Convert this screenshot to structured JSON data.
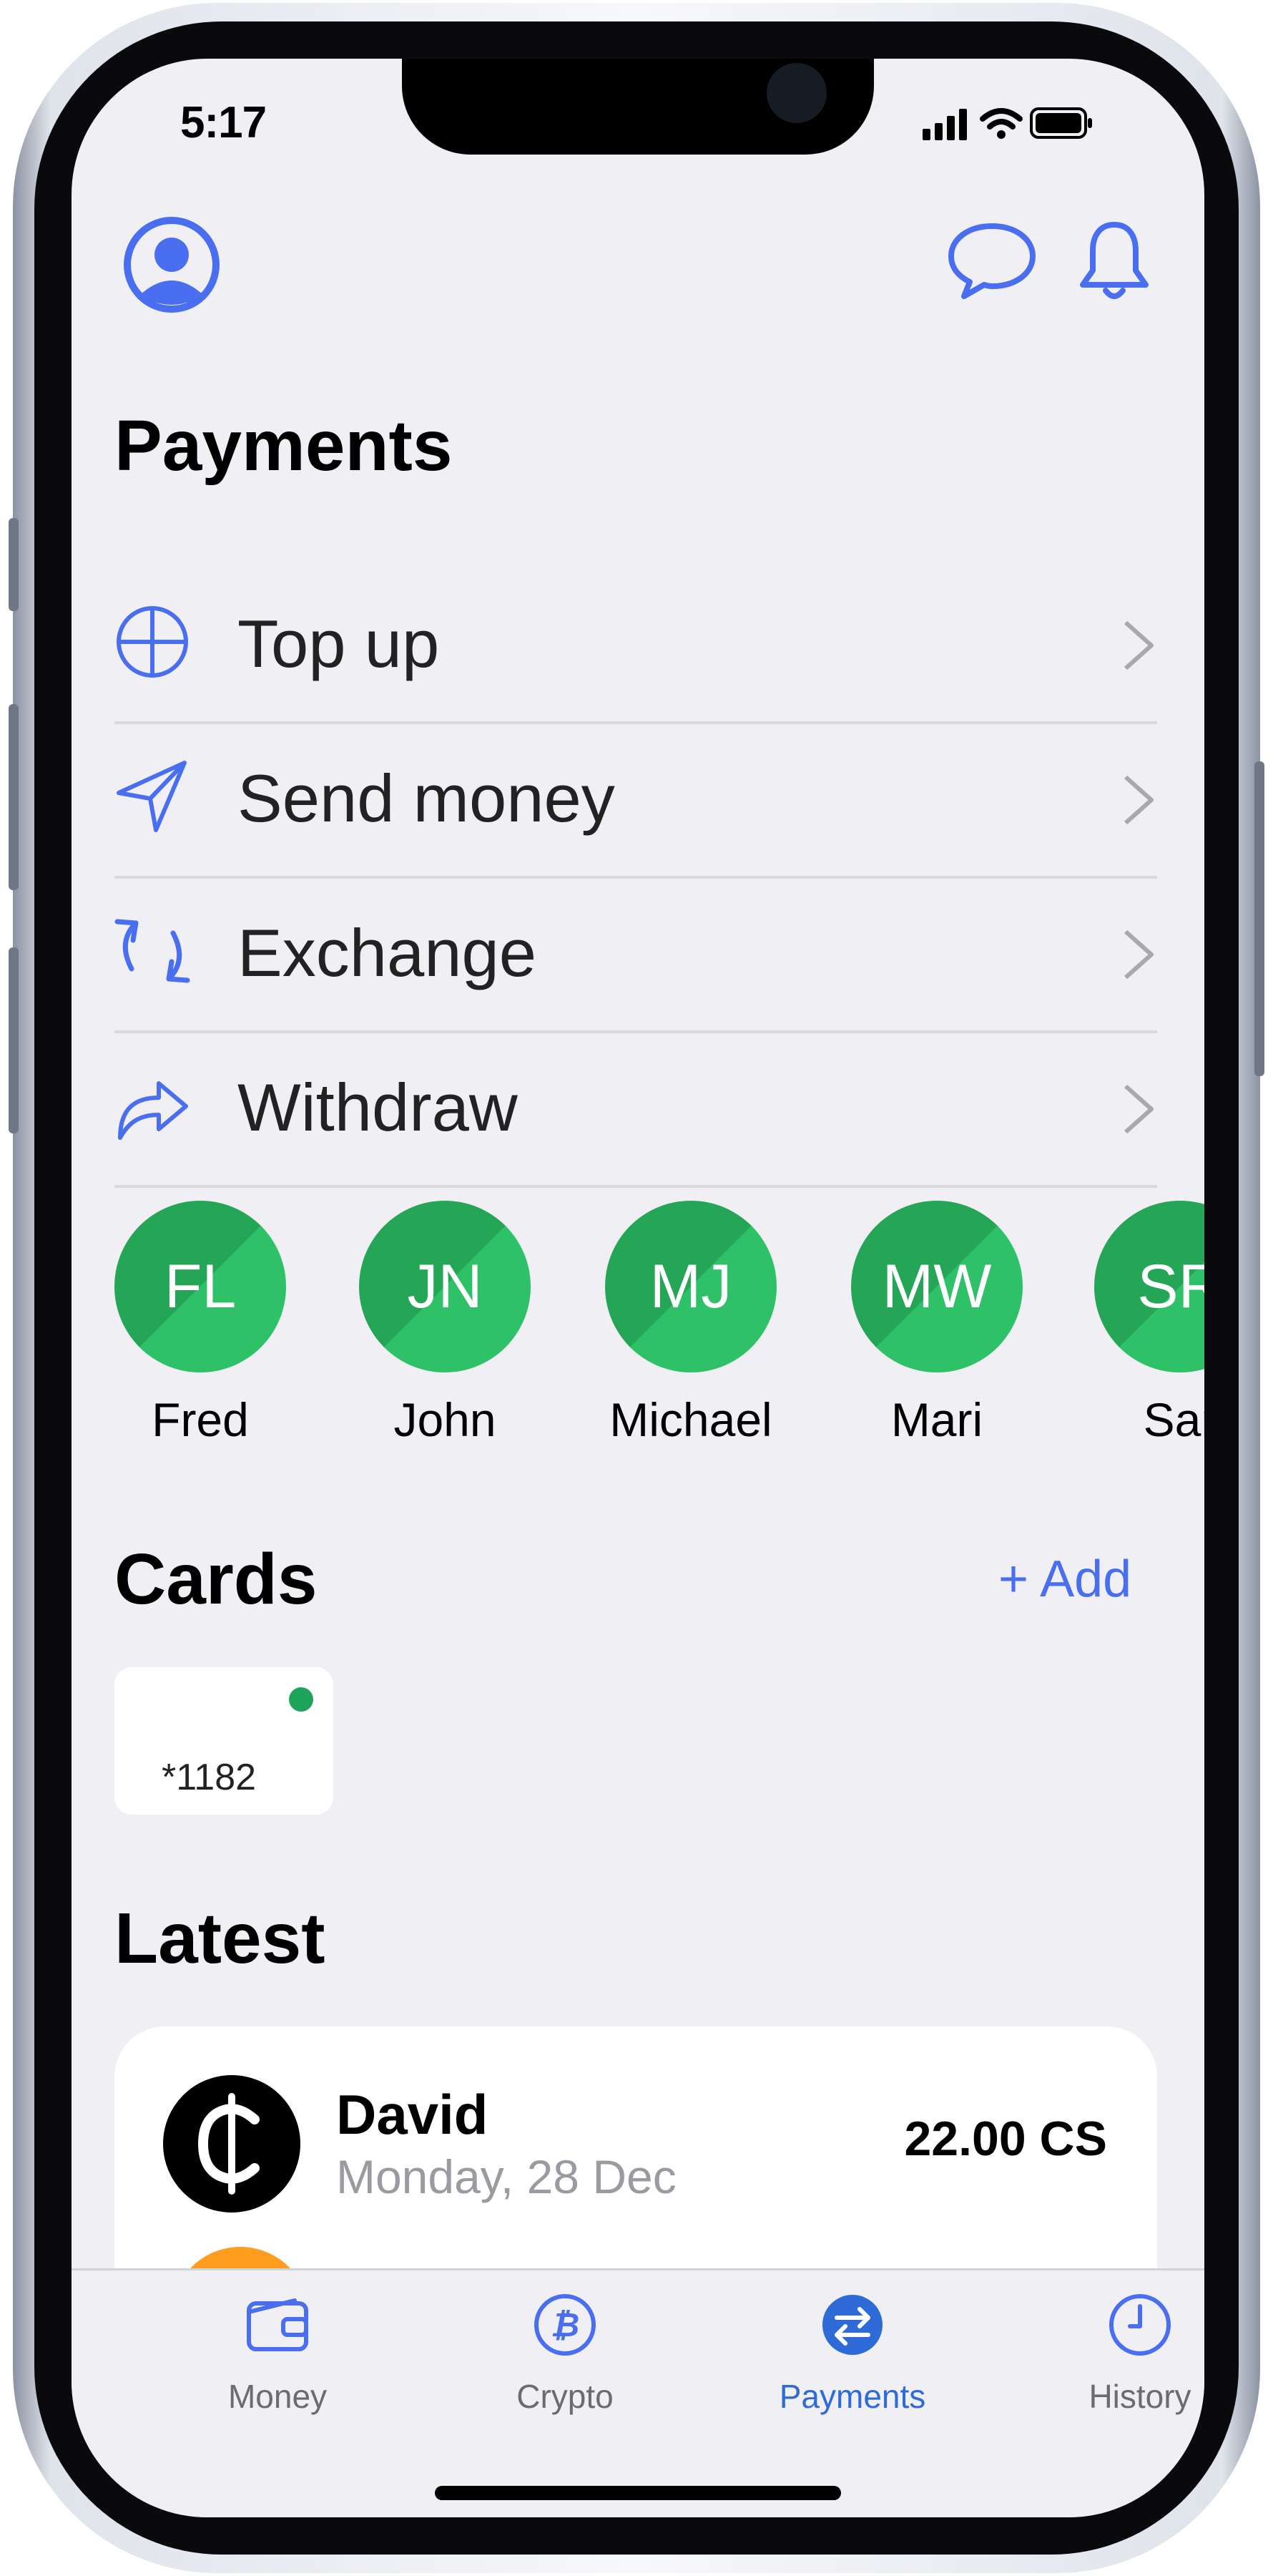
{
  "status_bar": {
    "time": "5:17"
  },
  "header": {
    "profile_icon": "user-circle-icon",
    "chat_icon": "chat-bubble-icon",
    "bell_icon": "bell-icon",
    "accent_color": "#4a6ef0"
  },
  "payments": {
    "title": "Payments",
    "items": [
      {
        "label": "Top up",
        "icon": "plus-circle-icon"
      },
      {
        "label": "Send money",
        "icon": "paper-plane-icon"
      },
      {
        "label": "Exchange",
        "icon": "refresh-arrows-icon"
      },
      {
        "label": "Withdraw",
        "icon": "share-arrow-icon"
      }
    ]
  },
  "contacts": [
    {
      "initials": "FL",
      "name": "Fred"
    },
    {
      "initials": "JN",
      "name": "John"
    },
    {
      "initials": "MJ",
      "name": "Michael"
    },
    {
      "initials": "MW",
      "name": "Mari"
    },
    {
      "initials": "SR",
      "name": "Sar"
    }
  ],
  "cards": {
    "title": "Cards",
    "add_label": "+ Add",
    "items": [
      {
        "number": "*1182",
        "status_color": "#1ea35a"
      }
    ]
  },
  "latest": {
    "title": "Latest",
    "transactions": [
      {
        "name": "David",
        "date": "Monday, 28 Dec",
        "amount": "22.00 CS",
        "icon": "cedi-sign-icon"
      }
    ]
  },
  "tabs": [
    {
      "label": "Money",
      "icon": "wallet-icon",
      "active": false
    },
    {
      "label": "Crypto",
      "icon": "bitcoin-icon",
      "active": false
    },
    {
      "label": "Payments",
      "icon": "transfer-arrows-icon",
      "active": true
    },
    {
      "label": "History",
      "icon": "clock-icon",
      "active": false
    }
  ]
}
